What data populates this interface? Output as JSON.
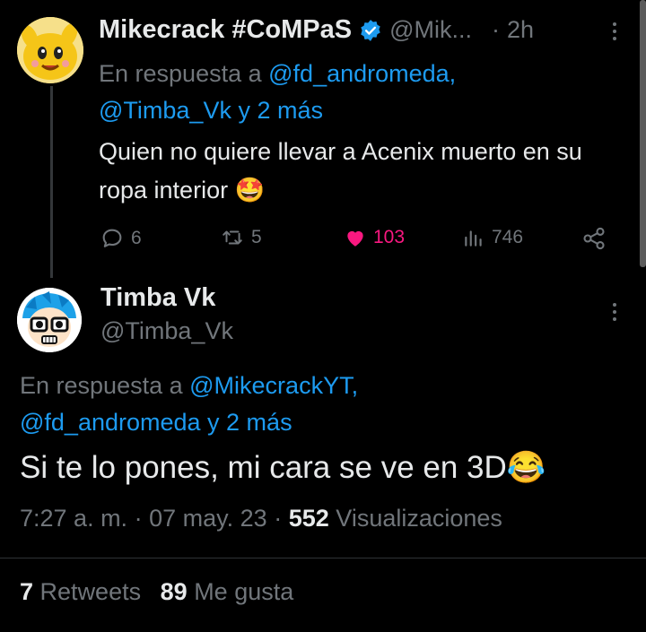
{
  "reply": {
    "display_name": "Mikecrack #CoMPaS",
    "handle": "@Mik...",
    "separator": "·",
    "time": "2h",
    "replying_prefix": "En respuesta a",
    "replying_to_1": "@fd_andromeda,",
    "replying_to_2": "@Timba_Vk y 2 más",
    "text": "Quien no quiere llevar a Acenix muerto en su ropa interior",
    "emoji": "🤩",
    "replies": "6",
    "retweets": "5",
    "likes": "103",
    "views": "746",
    "like_color": "#f91880",
    "verified_color": "#1d9bf0"
  },
  "main": {
    "display_name": "Timba Vk",
    "handle": "@Timba_Vk",
    "replying_prefix": "En respuesta a",
    "replying_to_1": "@MikecrackYT,",
    "replying_to_2": "@fd_andromeda y 2 más",
    "text": "Si te lo pones, mi cara se ve en 3D",
    "emoji": "😂",
    "time": "7:27 a. m.",
    "sep1": "·",
    "date": "07 may. 23",
    "sep2": "·",
    "views_count": "552",
    "views_label": "Visualizaciones",
    "retweets_count": "7",
    "retweets_label": "Retweets",
    "likes_count": "89",
    "likes_label": "Me gusta"
  },
  "colors": {
    "background": "#000000",
    "link": "#1d9bf0",
    "muted": "#71767b",
    "text": "#e7e9ea"
  }
}
